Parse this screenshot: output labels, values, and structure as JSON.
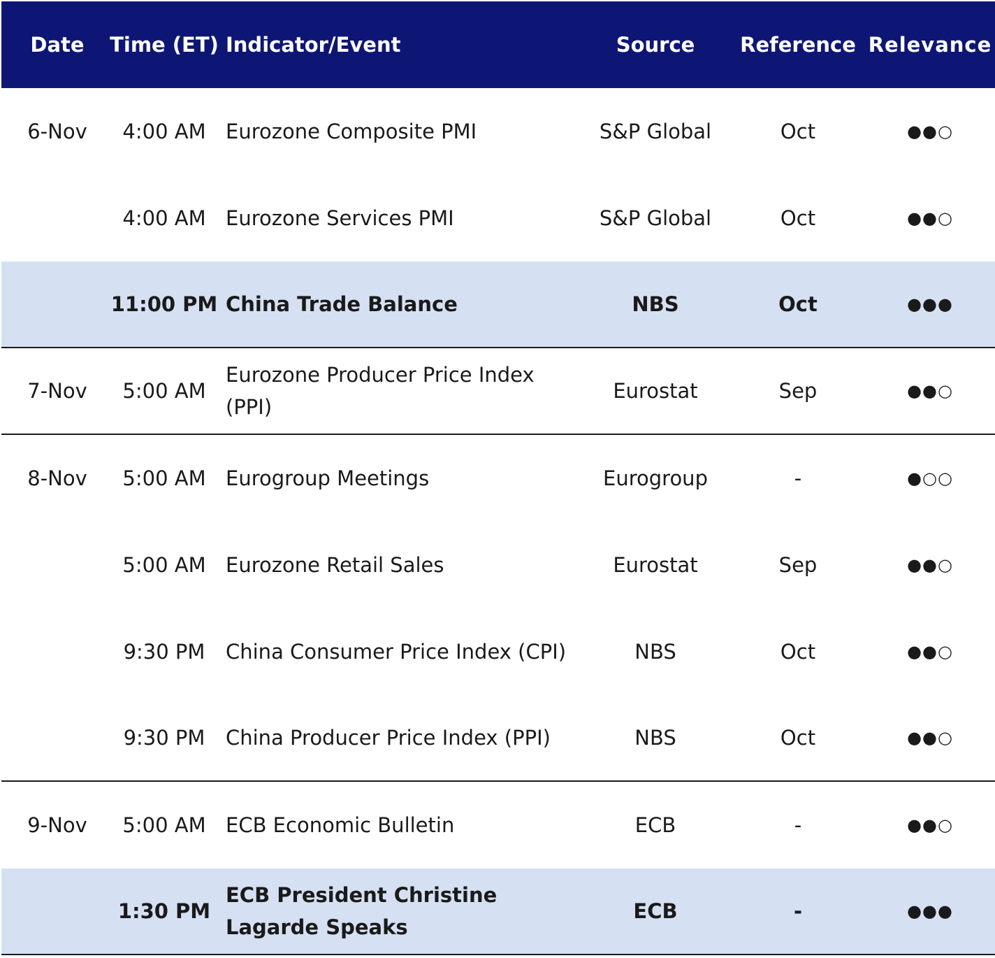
{
  "header": {
    "date": "Date",
    "time": "Time (ET)",
    "event": "Indicator/Event",
    "source": "Source",
    "reference": "Reference",
    "relevance": "Relevance"
  },
  "rows": [
    {
      "date": "6-Nov",
      "time": "4:00 AM",
      "event": "Eurozone Composite PMI",
      "source": "S&P Global",
      "reference": "Oct",
      "relevance": "●●○"
    },
    {
      "date": "",
      "time": "4:00 AM",
      "event": "Eurozone Services PMI",
      "source": "S&P Global",
      "reference": "Oct",
      "relevance": "●●○"
    },
    {
      "date": "",
      "time": "11:00 PM",
      "event": "China Trade Balance",
      "source": "NBS",
      "reference": "Oct",
      "relevance": "●●●"
    },
    {
      "date": "7-Nov",
      "time": "5:00 AM",
      "event": "Eurozone Producer Price Index (PPI)",
      "source": "Eurostat",
      "reference": "Sep",
      "relevance": "●●○"
    },
    {
      "date": "8-Nov",
      "time": "5:00 AM",
      "event": "Eurogroup Meetings",
      "source": "Eurogroup",
      "reference": "-",
      "relevance": "●○○"
    },
    {
      "date": "",
      "time": "5:00 AM",
      "event": "Eurozone Retail Sales",
      "source": "Eurostat",
      "reference": "Sep",
      "relevance": "●●○"
    },
    {
      "date": "",
      "time": "9:30 PM",
      "event": "China Consumer Price Index (CPI)",
      "source": "NBS",
      "reference": "Oct",
      "relevance": "●●○"
    },
    {
      "date": "",
      "time": "9:30 PM",
      "event": "China Producer Price Index (PPI)",
      "source": "NBS",
      "reference": "Oct",
      "relevance": "●●○"
    },
    {
      "date": "9-Nov",
      "time": "5:00 AM",
      "event": "ECB Economic Bulletin",
      "source": "ECB",
      "reference": "-",
      "relevance": "●●○"
    },
    {
      "date": "",
      "time": "1:30 PM",
      "event": "ECB President Christine Lagarde Speaks",
      "source": "ECB",
      "reference": "-",
      "relevance": "●●●"
    }
  ],
  "colors": {
    "header_bg": "#0e1675",
    "highlight_row_bg": "#d6e0f3"
  }
}
